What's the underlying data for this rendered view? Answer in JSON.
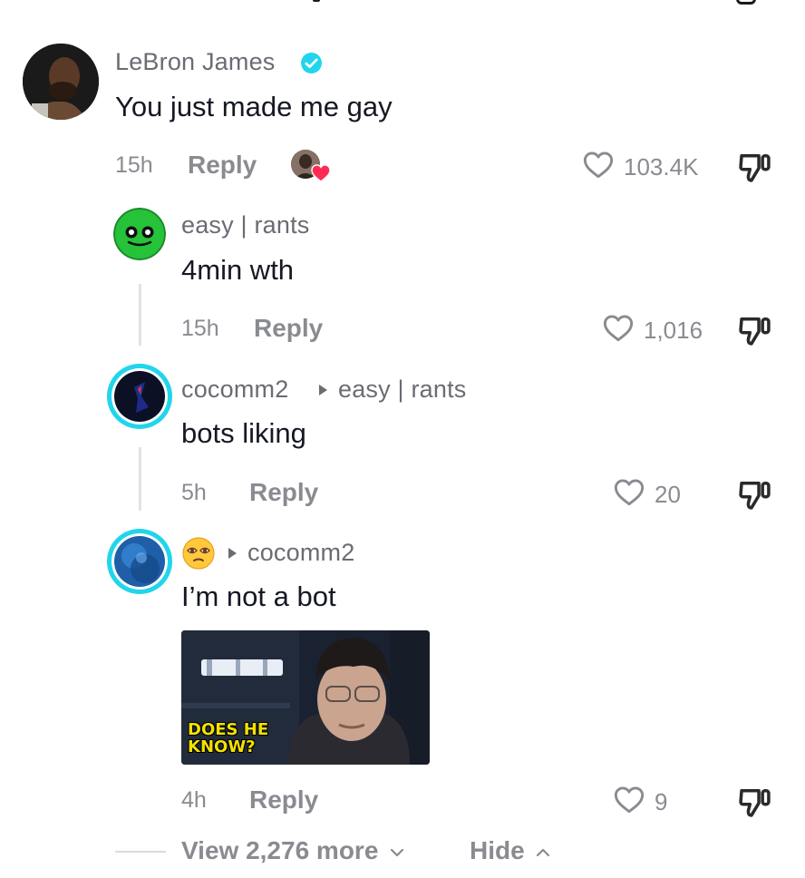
{
  "comments": [
    {
      "author": "LeBron James",
      "verified": true,
      "text": "You just made me gay",
      "time": "15h",
      "reply_label": "Reply",
      "likes": "103.4K"
    },
    {
      "author": "easy | rants",
      "text": "4min wth",
      "time": "15h",
      "reply_label": "Reply",
      "likes": "1,016"
    },
    {
      "author": "cocomm2",
      "reply_to": "easy | rants",
      "text": "bots liking",
      "time": "5h",
      "reply_label": "Reply",
      "likes": "20"
    },
    {
      "author_emoji": "😵‍💫",
      "reply_to": "cocomm2",
      "text": "I’m not a bot",
      "image_caption": "DOES HE\nKNOW?",
      "time": "4h",
      "reply_label": "Reply",
      "likes": "9"
    }
  ],
  "footer": {
    "view_more": "View 2,276 more",
    "hide": "Hide"
  },
  "colors": {
    "verified": "#20D5EC",
    "like_heart_badge": "#FE2C55",
    "avatar_ring": "#20D5EC",
    "meme_caption": "#F3E100"
  }
}
